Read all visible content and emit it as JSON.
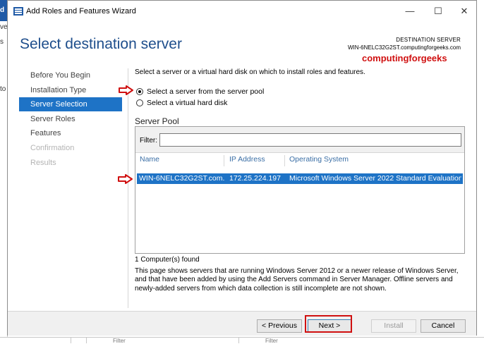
{
  "background": {
    "left_fragments": [
      "d",
      "ve",
      "s",
      "to"
    ],
    "bottom_fragments": [
      "Filter",
      "Filter"
    ]
  },
  "window": {
    "title": "Add Roles and Features Wizard",
    "controls": {
      "minimize": "—",
      "maximize": "☐",
      "close": "✕"
    }
  },
  "header": {
    "title": "Select destination server",
    "destination_label": "DESTINATION SERVER",
    "destination_value": "WIN-6NELC32G2ST.computingforgeeks.com",
    "watermark": "computingforgeeks"
  },
  "nav": {
    "items": [
      {
        "label": "Before You Begin",
        "state": "normal"
      },
      {
        "label": "Installation Type",
        "state": "normal"
      },
      {
        "label": "Server Selection",
        "state": "active"
      },
      {
        "label": "Server Roles",
        "state": "normal"
      },
      {
        "label": "Features",
        "state": "normal"
      },
      {
        "label": "Confirmation",
        "state": "disabled"
      },
      {
        "label": "Results",
        "state": "disabled"
      }
    ]
  },
  "main": {
    "intro": "Select a server or a virtual hard disk on which to install roles and features.",
    "options": [
      {
        "label": "Select a server from the server pool",
        "selected": true
      },
      {
        "label": "Select a virtual hard disk",
        "selected": false
      }
    ],
    "server_pool_label": "Server Pool",
    "filter_label": "Filter:",
    "filter_value": "",
    "columns": [
      "Name",
      "IP Address",
      "Operating System"
    ],
    "rows": [
      {
        "name": "WIN-6NELC32G2ST.com...",
        "ip": "172.25.224.197",
        "os": "Microsoft Windows Server 2022 Standard Evaluation",
        "selected": true
      }
    ],
    "found_text": "1 Computer(s) found",
    "description": "This page shows servers that are running Windows Server 2012 or a newer release of Windows Server, and that have been added by using the Add Servers command in Server Manager. Offline servers and newly-added servers from which data collection is still incomplete are not shown."
  },
  "footer": {
    "previous": "< Previous",
    "next": "Next >",
    "install": "Install",
    "cancel": "Cancel"
  },
  "colors": {
    "accent": "#1e73c6",
    "title_blue": "#1e4e8c",
    "annotation_red": "#d01010"
  }
}
